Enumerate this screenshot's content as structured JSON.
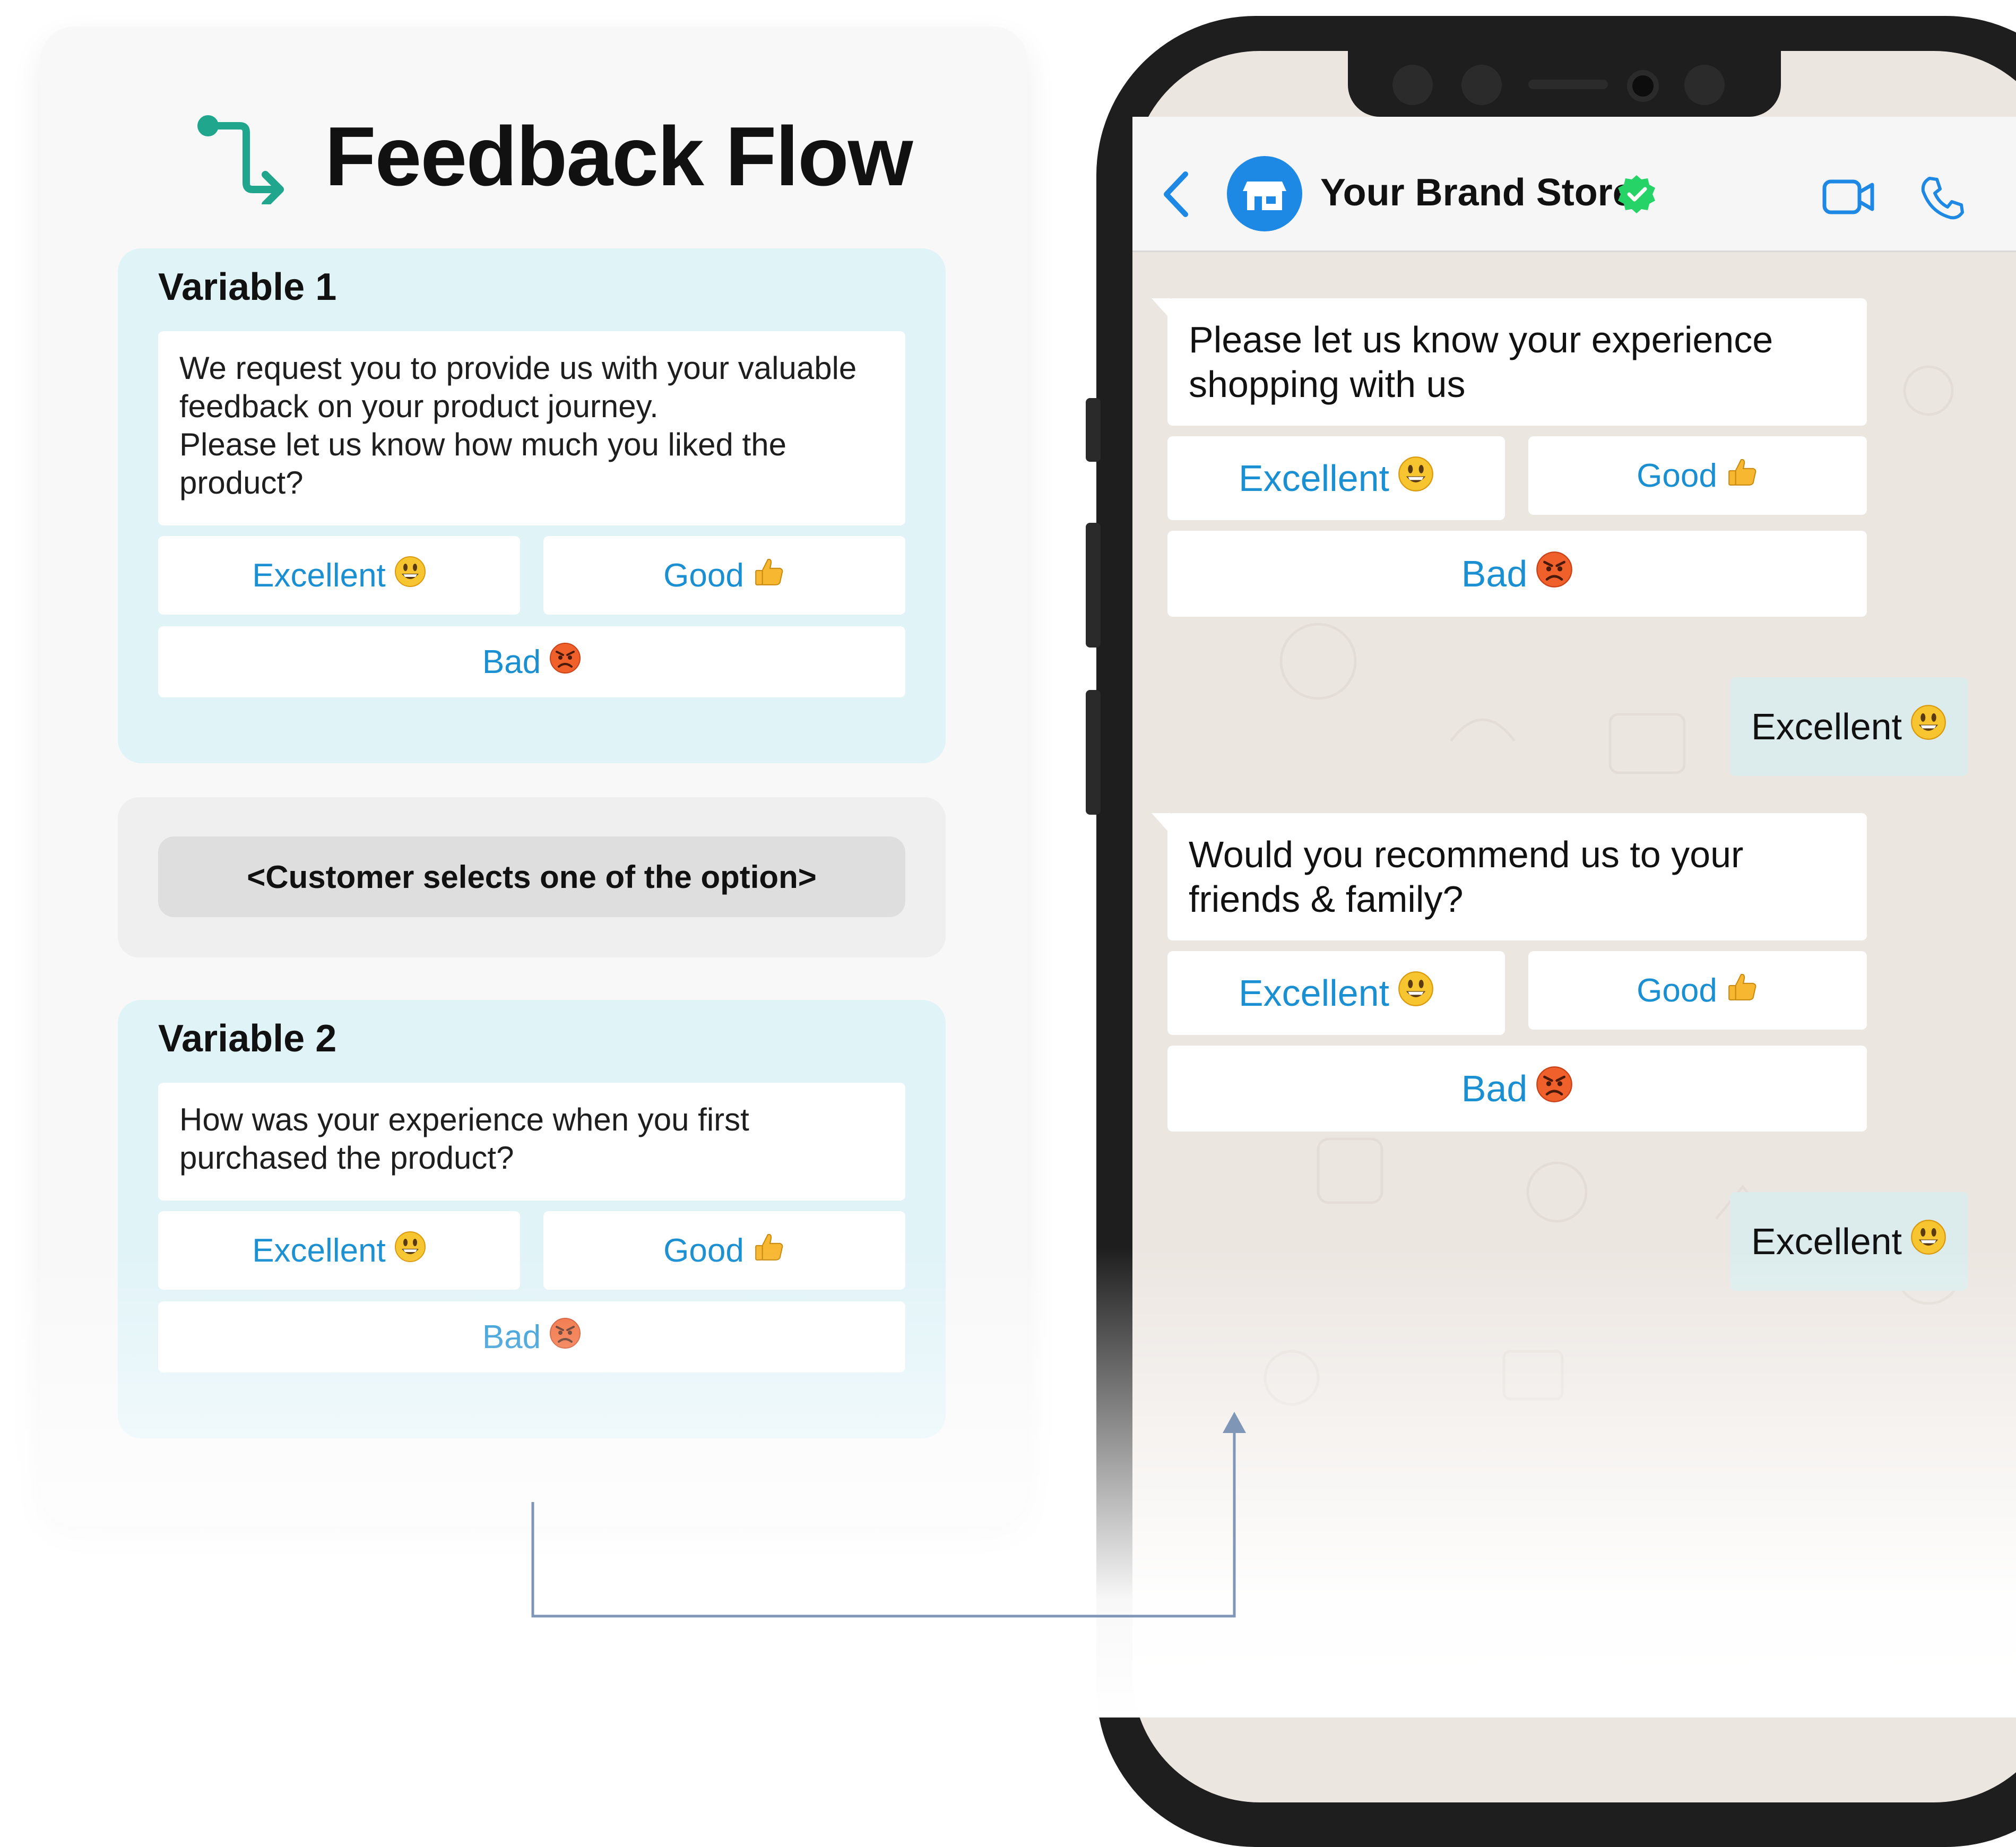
{
  "flow": {
    "title": "Feedback Flow",
    "variable1": {
      "title": "Variable 1",
      "message_lines": [
        "We request you to provide us with your valuable",
        "feedback on your product journey.",
        "Please let us know how much you liked the",
        "product?"
      ],
      "options": [
        "Excellent",
        "Good",
        "Bad"
      ]
    },
    "selection_note": "<Customer selects one of the option>",
    "variable2": {
      "title": "Variable 2",
      "message_lines": [
        "How was your experience when you first",
        "purchased the product?"
      ],
      "options": [
        "Excellent",
        "Good",
        "Bad"
      ]
    }
  },
  "chat": {
    "brand_name": "Your Brand Store",
    "verified_icon": "verified-badge-icon",
    "message1_lines": [
      "Please let us know your experience",
      "shopping with us"
    ],
    "message1_options": [
      "Excellent",
      "Good",
      "Bad"
    ],
    "reply1": "Excellent",
    "message2_lines": [
      "Would you recommend us to your",
      "friends & family?"
    ],
    "message2_options": [
      "Excellent",
      "Good",
      "Bad"
    ],
    "reply2": "Excellent"
  },
  "colors": {
    "accent_teal": "#1fa68c",
    "link_blue": "#1a8fd1",
    "brand_blue": "#1e88e5",
    "verified_green": "#25d366",
    "variable_bg": "#e0f3f7",
    "connector": "#7f96b6"
  }
}
